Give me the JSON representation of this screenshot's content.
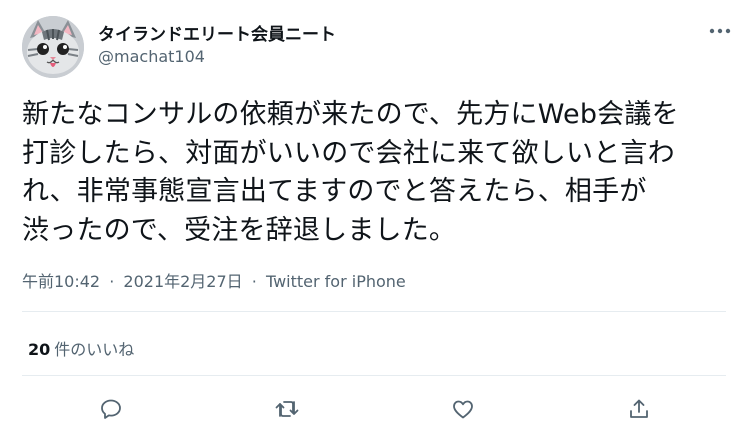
{
  "author": {
    "display_name": "タイランドエリート会員ニート",
    "handle": "@machat104"
  },
  "tweet": {
    "lines": [
      "新たなコンサルの依頼が来たので、先方にWeb会議を",
      "打診したら、対面がいいので会社に来て欲しいと言わ",
      "れ、非常事態宣言出てますのでと答えたら、相手が",
      "渋ったので、受注を辞退しました。"
    ],
    "time": "午前10:42",
    "date": "2021年2月27日",
    "source": "Twitter for iPhone",
    "separator": "·"
  },
  "stats": {
    "likes_count": "20",
    "likes_label": "件のいいね"
  },
  "actions": {
    "icons": [
      "reply-icon",
      "retweet-icon",
      "like-icon",
      "share-icon"
    ]
  },
  "colors": {
    "text": "#0f1419",
    "secondary": "#536471",
    "divider": "#e6ecf0",
    "icon": "#536471"
  }
}
